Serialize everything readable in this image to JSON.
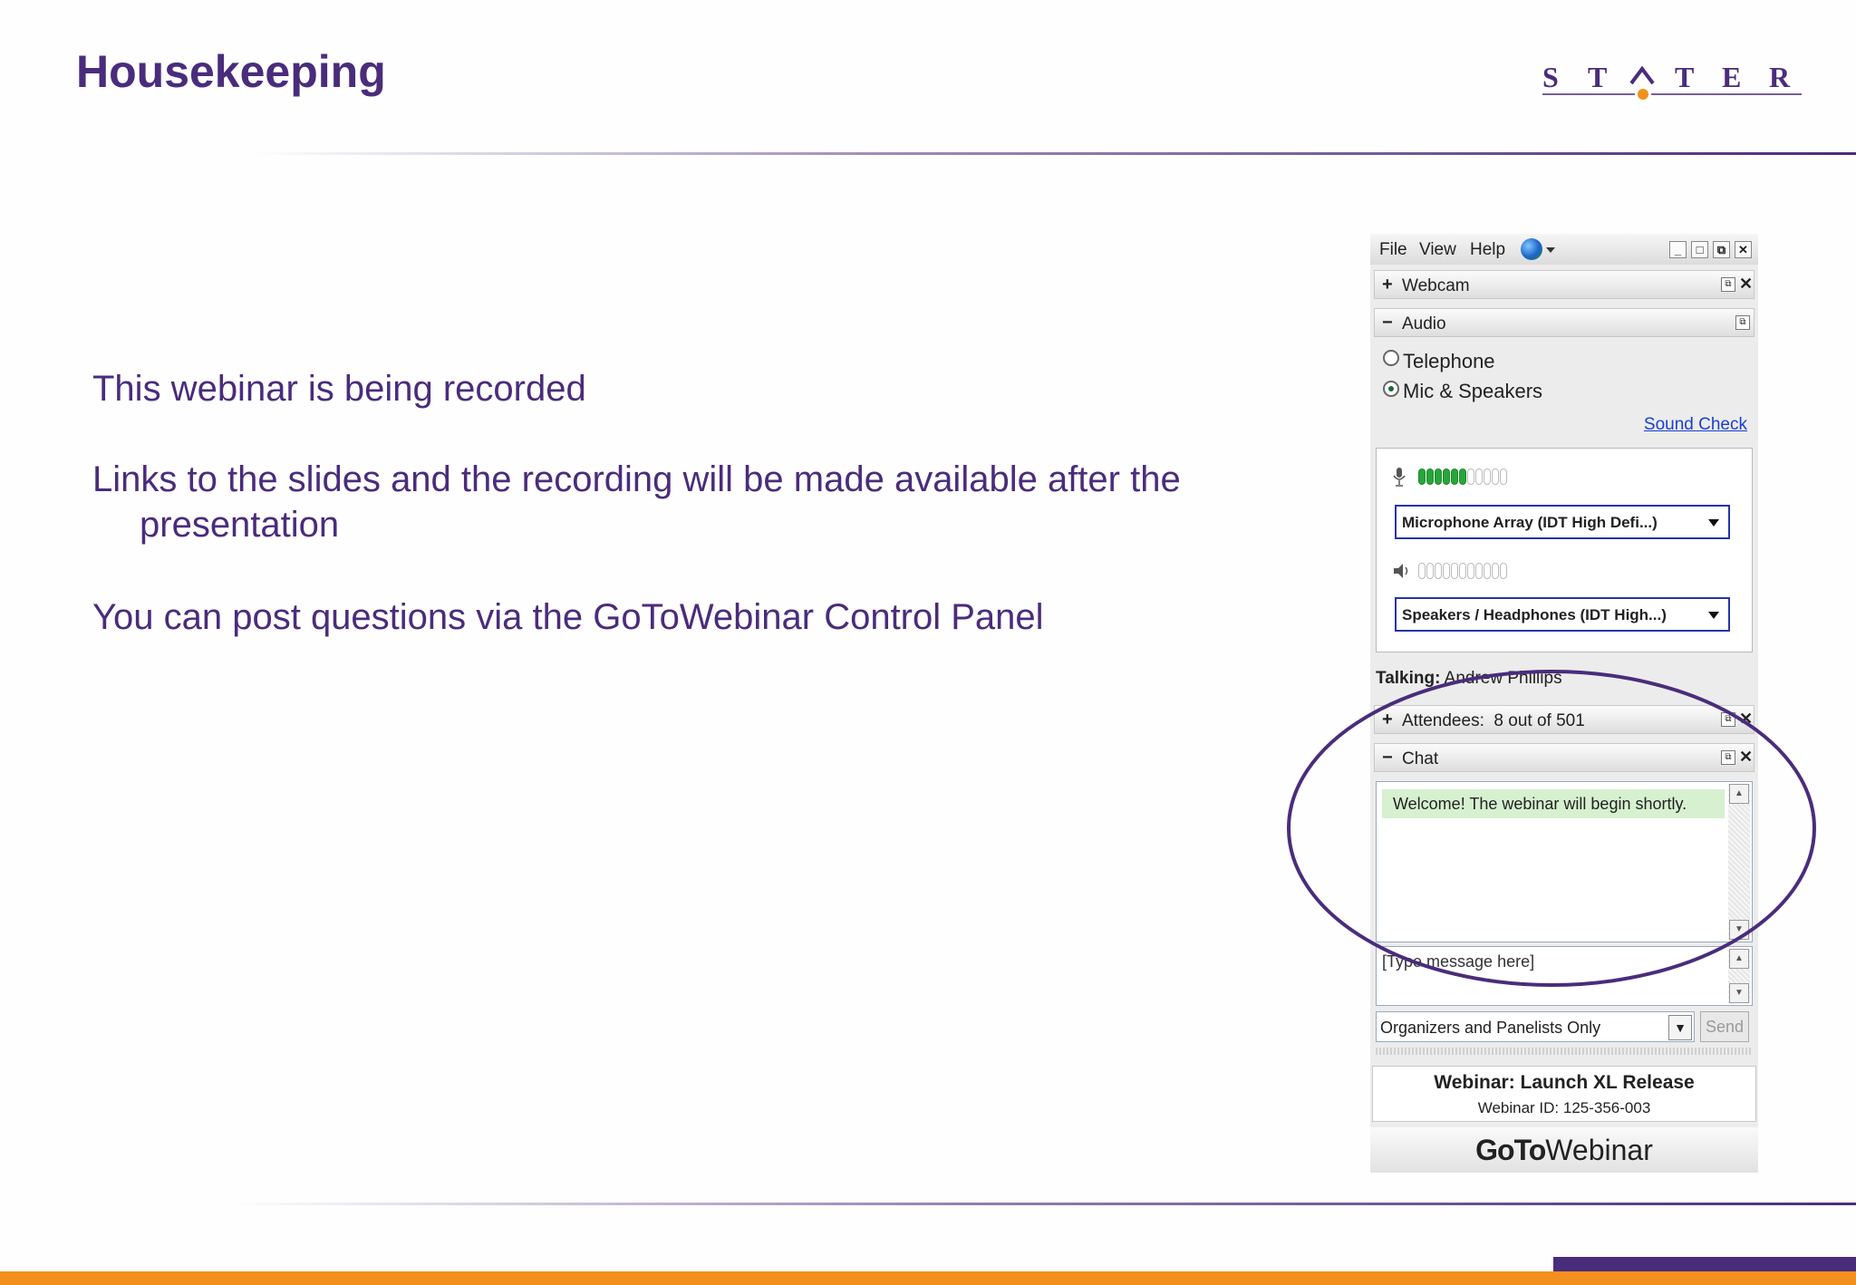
{
  "slide": {
    "title": "Housekeeping",
    "logo_text": "STATER",
    "bullets": [
      "This webinar is being recorded",
      "Links to the slides and the recording will be made available after the",
      "presentation",
      "You can post questions via the GoToWebinar Control Panel"
    ],
    "colors": {
      "title": "#4a2c7c",
      "accent_orange": "#f3901d",
      "accent_purple": "#4a2c7c"
    }
  },
  "panel": {
    "menu": [
      "File",
      "View",
      "Help"
    ],
    "webcam_label": "Webcam",
    "audio_label": "Audio",
    "audio_options": [
      "Telephone",
      "Mic & Speakers"
    ],
    "audio_selected": "Mic & Speakers",
    "sound_check": "Sound Check",
    "mic_level": 6,
    "mic_level_max": 11,
    "speaker_level": 0,
    "microphone_device": "Microphone Array (IDT High Defi...)",
    "speaker_device": "Speakers / Headphones (IDT High...)",
    "talking_label": "Talking:",
    "talking_name": "Andrew Phillips",
    "attendees_label": "Attendees:",
    "attendees_value": "8 out of 501",
    "chat_label": "Chat",
    "chat_message": "Welcome! The webinar will begin shortly.",
    "message_placeholder": "[Type message here]",
    "recipient": "Organizers and Panelists Only",
    "send_label": "Send",
    "webinar_title": "Webinar: Launch XL Release",
    "webinar_id": "Webinar ID: 125-356-003",
    "brand_go": "GoTo",
    "brand_rest": "Webinar"
  }
}
